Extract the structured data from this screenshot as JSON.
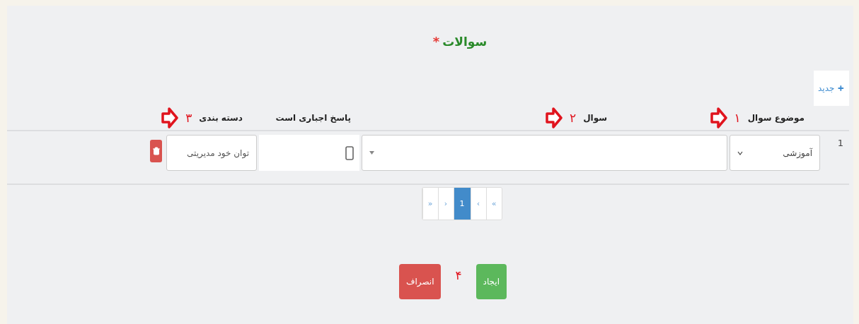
{
  "title": {
    "text": "سوالات",
    "required_mark": "*"
  },
  "new_button": {
    "label": "جدید"
  },
  "columns": [
    {
      "label": "موضوع سوال",
      "annotation": "۱"
    },
    {
      "label": "سوال",
      "annotation": "۲"
    },
    {
      "label": "پاسخ اجباری است"
    },
    {
      "label": "دسته بندی",
      "annotation": "۳"
    }
  ],
  "rows": [
    {
      "number": "1",
      "topic": "آموزشی",
      "mandatory": false,
      "category": "توان خود مدیریتی"
    }
  ],
  "pagination": [
    {
      "label": "»",
      "selected": false
    },
    {
      "label": "›",
      "selected": false
    },
    {
      "label": "1",
      "selected": true
    },
    {
      "label": "‹",
      "selected": false
    },
    {
      "label": "«",
      "selected": false
    }
  ],
  "buttons": [
    {
      "label": "ایجاد",
      "kind": "primary",
      "annotation": "۴"
    },
    {
      "label": "انصراف",
      "kind": "danger"
    }
  ]
}
